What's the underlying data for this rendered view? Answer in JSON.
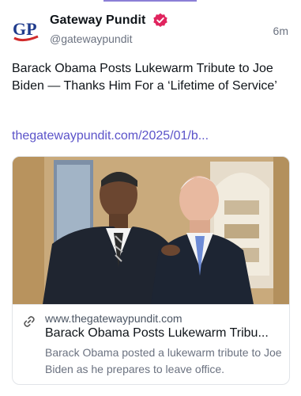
{
  "author": {
    "name": "Gateway Pundit",
    "handle": "@gatewaypundit",
    "avatar_text": "GP",
    "verified": true,
    "verified_color": "#e0245e"
  },
  "post": {
    "timestamp": "6m",
    "text": "Barack Obama Posts Lukewarm Tribute to Joe Biden — Thanks Him For a ‘Lifetime of Service’",
    "link_text": "thegatewaypundit.com/2025/01/b...",
    "link_color": "#5b53c9"
  },
  "card": {
    "image_icon": "photo-two-men-suits",
    "link_icon": "link-icon",
    "domain": "www.thegatewaypundit.com",
    "title": "Barack Obama Posts Lukewarm Tribu...",
    "description": "Barack Obama posted a lukewarm tribute to Joe Biden as he prepares to leave office."
  }
}
